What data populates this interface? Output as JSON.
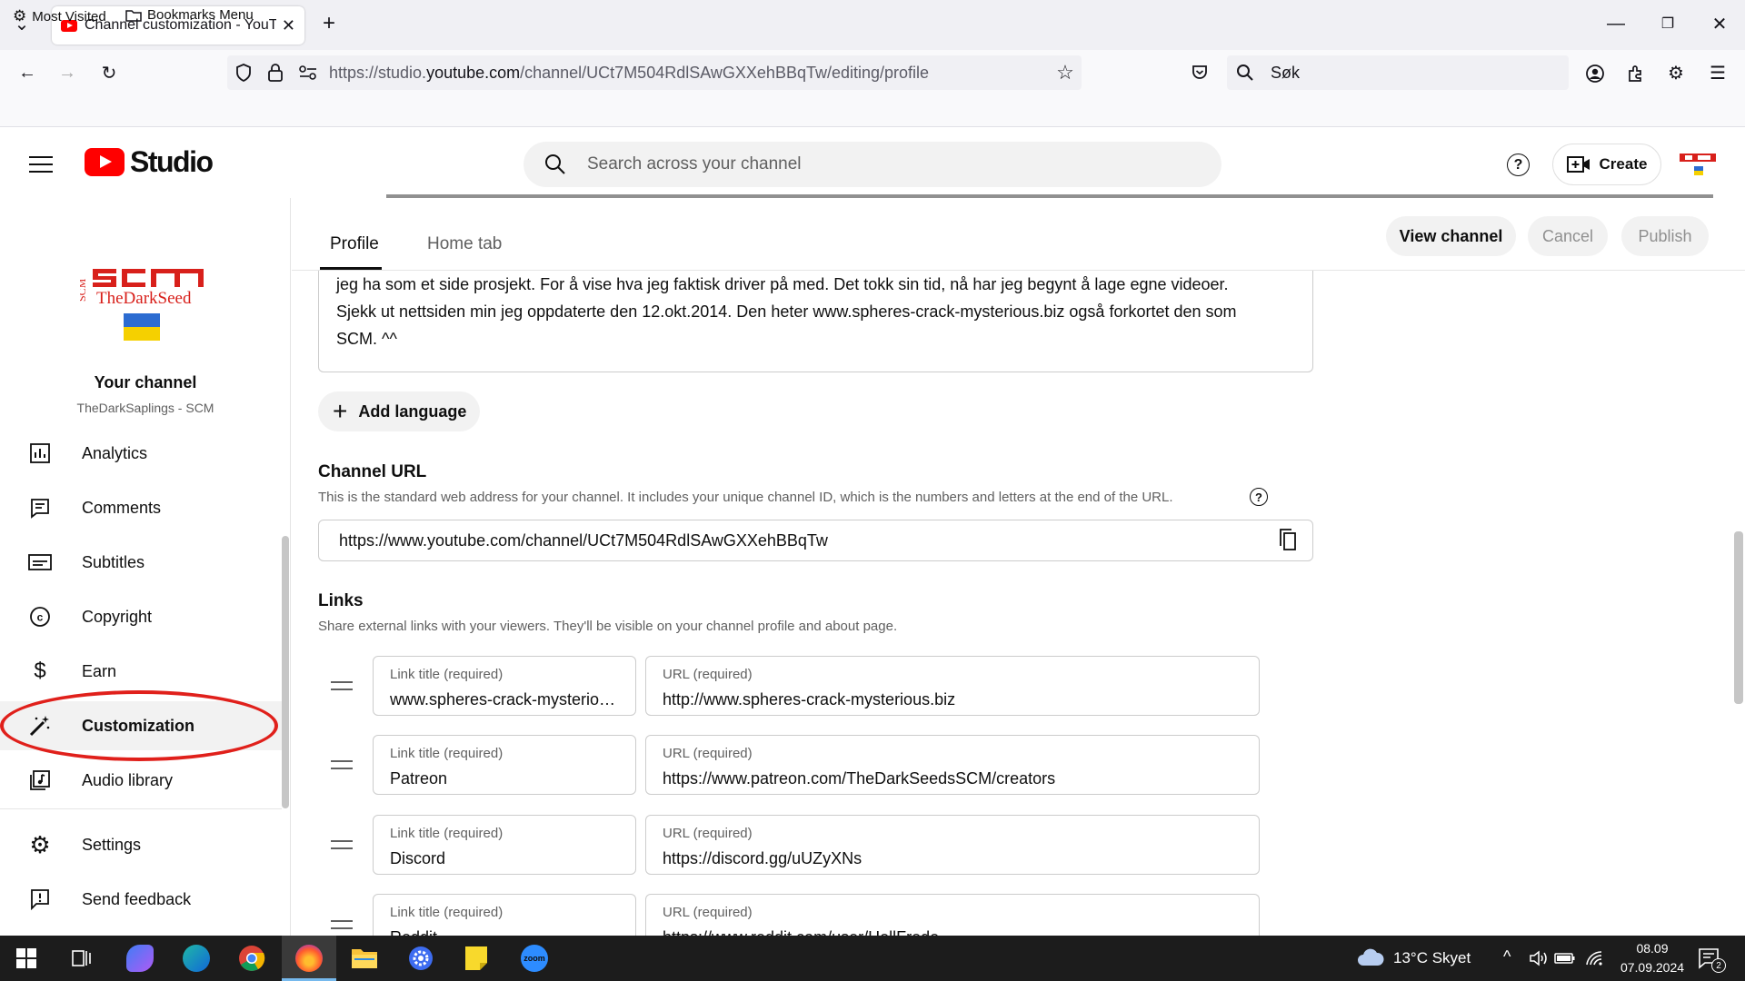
{
  "browser": {
    "tab_title": "Channel customization - YouTube Studio",
    "url_prefix": "https://studio.",
    "url_domain": "youtube.com",
    "url_path": "/channel/UCt7M504RdlSAwGXXehBBqTw/editing/profile",
    "search_placeholder": "Søk",
    "bookmark_most_visited": "Most Visited",
    "bookmark_menu": "Bookmarks Menu"
  },
  "header": {
    "logo_text": "Studio",
    "search_placeholder": "Search across your channel",
    "create_label": "Create"
  },
  "sidebar": {
    "channel_title": "Your channel",
    "channel_name": "TheDarkSaplings - SCM",
    "avatar_text": "TheDarkSeed",
    "avatar_side": "SCM",
    "items": [
      {
        "label": "Analytics"
      },
      {
        "label": "Comments"
      },
      {
        "label": "Subtitles"
      },
      {
        "label": "Copyright"
      },
      {
        "label": "Earn"
      },
      {
        "label": "Customization"
      },
      {
        "label": "Audio library"
      },
      {
        "label": "Settings"
      },
      {
        "label": "Send feedback"
      }
    ]
  },
  "main": {
    "tabs": [
      {
        "label": "Profile"
      },
      {
        "label": "Home tab"
      }
    ],
    "view_channel": "View channel",
    "cancel": "Cancel",
    "publish": "Publish",
    "description_lines": [
      "jeg ha som et side prosjekt. For å vise hva jeg faktisk driver på med. Det tokk sin tid, nå har jeg begynt å lage egne videoer.",
      "Sjekk ut nettsiden min jeg oppdaterte den 12.okt.2014. Den heter www.spheres-crack-mysterious.biz også forkortet den som",
      "SCM. ^^"
    ],
    "add_language": "Add language",
    "channel_url_title": "Channel URL",
    "channel_url_desc": "This is the standard web address for your channel. It includes your unique channel ID, which is the numbers and letters at the end of the URL.",
    "channel_url_value": "https://www.youtube.com/channel/UCt7M504RdlSAwGXXehBBqTw",
    "links_title": "Links",
    "links_desc": "Share external links with your viewers. They'll be visible on your channel profile and about page.",
    "link_title_label": "Link title (required)",
    "link_url_label": "URL (required)",
    "links": [
      {
        "title": "www.spheres-crack-mysterious.biz",
        "url": "http://www.spheres-crack-mysterious.biz"
      },
      {
        "title": "Patreon",
        "url": "https://www.patreon.com/TheDarkSeedsSCM/creators"
      },
      {
        "title": "Discord",
        "url": "https://discord.gg/uUZyXNs"
      },
      {
        "title": "Reddit",
        "url": "https://www.reddit.com/user/HellFrede"
      }
    ]
  },
  "taskbar": {
    "weather": "13°C  Skyet",
    "time": "08.09",
    "date": "07.09.2024",
    "notifications": "2",
    "zoom_label": "zoom"
  }
}
